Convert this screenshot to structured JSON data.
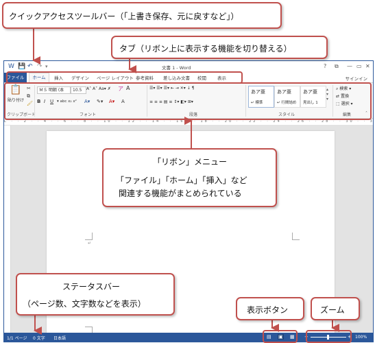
{
  "window": {
    "title": "文書 1 - Word",
    "sign_in": "サインイン",
    "help": "?",
    "min": "—",
    "restore": "▭",
    "close": "✕"
  },
  "tabs": {
    "file": "ファイル",
    "home": "ホーム",
    "insert": "挿入",
    "design": "デザイン",
    "page_layout": "ページ レイアウト",
    "references": "参考資料",
    "mailings": "差し込み文書",
    "review": "校閲",
    "view": "表示"
  },
  "ribbon": {
    "paste": "貼り付け",
    "font_name": "ＭＳ 明朝 (本",
    "font_size": "10.5",
    "clipboard_label": "クリップボード",
    "font_label": "フォント",
    "paragraph_label": "段落",
    "styles_label": "スタイル",
    "editing_label": "編集",
    "styles": [
      {
        "preview": "あア亜",
        "name": "↵ 標準"
      },
      {
        "preview": "あア亜",
        "name": "↵ 行間詰め"
      },
      {
        "preview": "あア亜",
        "name": "見出し 1"
      }
    ],
    "find": "検索",
    "replace": "置換",
    "select": "選択"
  },
  "status": {
    "page": "1/1 ページ",
    "words": "0 文字",
    "language": "日本語",
    "zoom": "100%"
  },
  "callouts": {
    "quick_access": "クイックアクセスツールバー（「上書き保存、元に戻すなど」）",
    "tabs": "タブ（リボン上に表示する機能を切り替える）",
    "ribbon_title": "「リボン」メニュー",
    "ribbon_line1": "「ファイル」「ホーム」「挿入」など",
    "ribbon_line2": "関連する機能がまとめられている",
    "status_title": "ステータスバー",
    "status_desc": "（ページ数、文字数などを表示）",
    "view_buttons": "表示ボタン",
    "zoom": "ズーム"
  },
  "colors": {
    "word_blue": "#2b579a",
    "callout_red": "#c0504d"
  }
}
